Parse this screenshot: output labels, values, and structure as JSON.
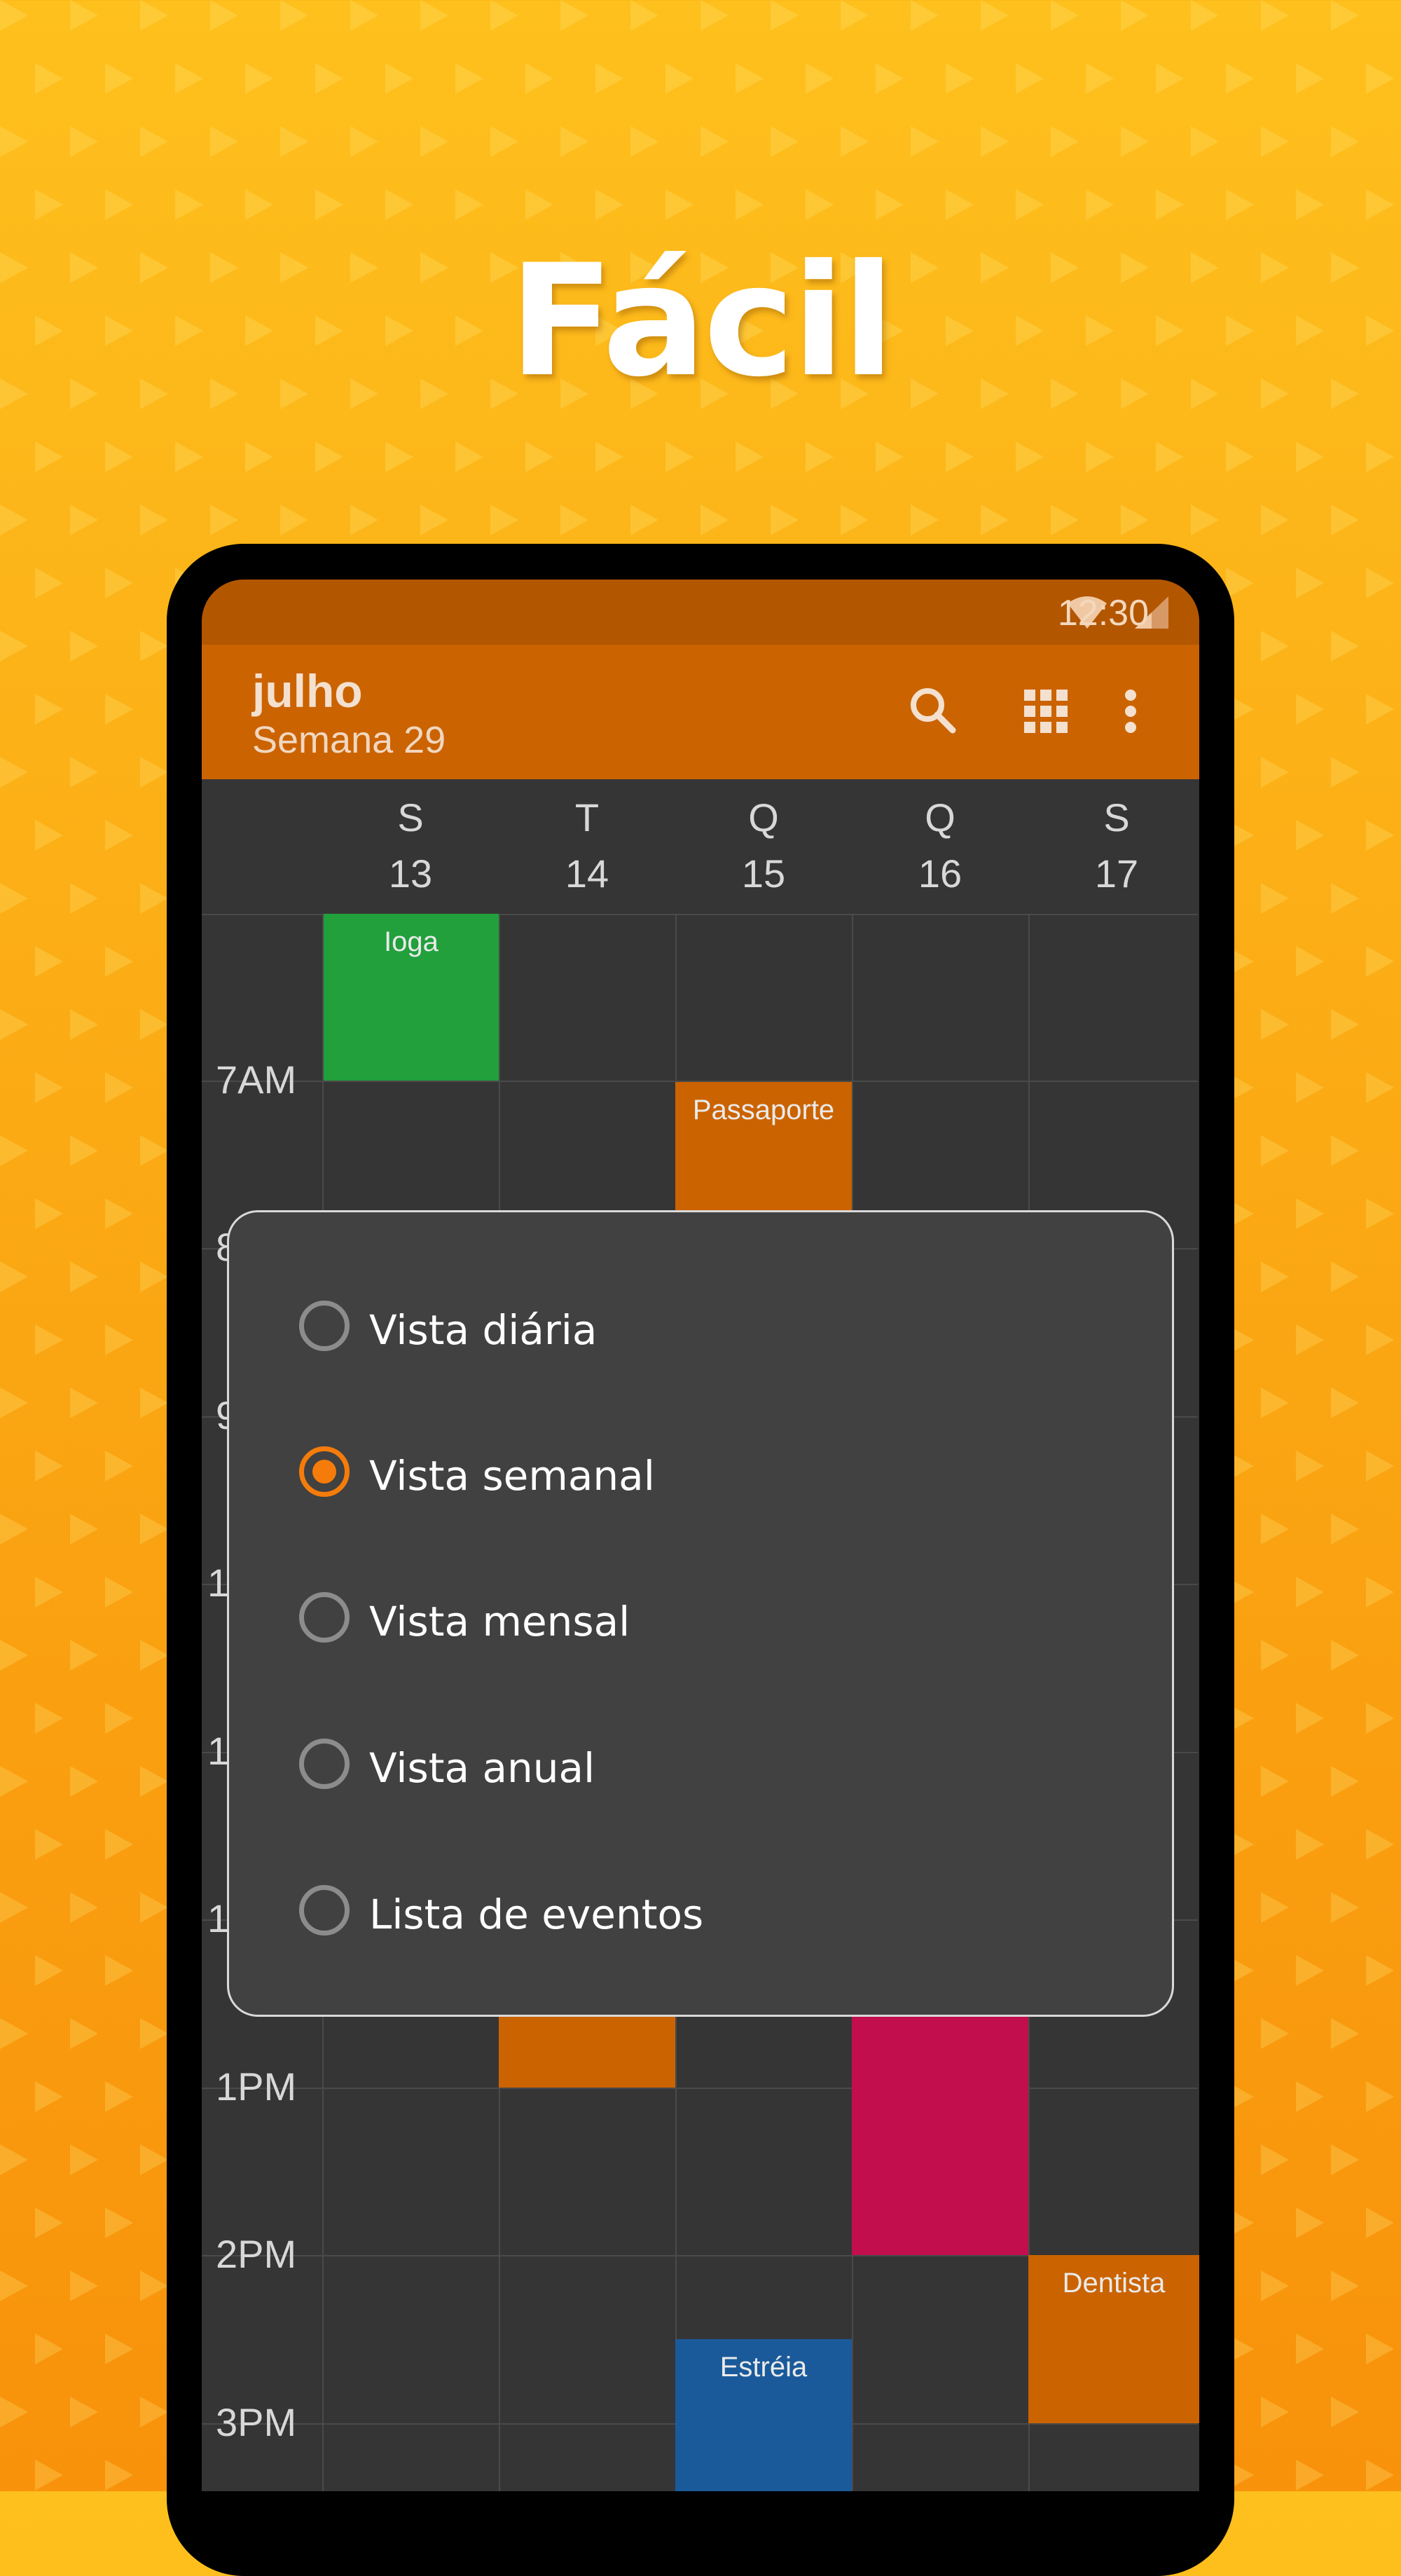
{
  "headline": "Fácil",
  "status_bar": {
    "time": "12:30",
    "icons": [
      "wifi-icon",
      "signal-icon",
      "battery-icon"
    ]
  },
  "app_bar": {
    "month": "julho",
    "week": "Semana 29",
    "actions": [
      "search-icon",
      "grid-apps-icon",
      "more-vert-icon"
    ]
  },
  "days": [
    {
      "letter": "S",
      "number": "13"
    },
    {
      "letter": "T",
      "number": "14"
    },
    {
      "letter": "Q",
      "number": "15"
    },
    {
      "letter": "Q",
      "number": "16"
    },
    {
      "letter": "S",
      "number": "17"
    }
  ],
  "time_labels": [
    "7AM",
    "8",
    "9",
    "1",
    "1",
    "1",
    "1PM",
    "2PM",
    "3PM"
  ],
  "events": [
    {
      "title": "Ioga",
      "color": "#21a03c"
    },
    {
      "title": "Passaporte",
      "color": "#cb6300"
    },
    {
      "title": "",
      "color": "#cb6300"
    },
    {
      "title": "",
      "color": "#c20e4c"
    },
    {
      "title": "Dentista",
      "color": "#cb6300"
    },
    {
      "title": "Estréia",
      "color": "#1a5a9a"
    }
  ],
  "dialog": {
    "options": [
      {
        "label": "Vista diária",
        "selected": false
      },
      {
        "label": "Vista semanal",
        "selected": true
      },
      {
        "label": "Vista mensal",
        "selected": false
      },
      {
        "label": "Vista anual",
        "selected": false
      },
      {
        "label": "Lista de eventos",
        "selected": false
      }
    ]
  },
  "colors": {
    "accent": "#f57c0a",
    "status_bar": "#b35600",
    "app_bar": "#cb6300",
    "calendar_bg": "#353535",
    "dialog_bg": "#414141"
  }
}
